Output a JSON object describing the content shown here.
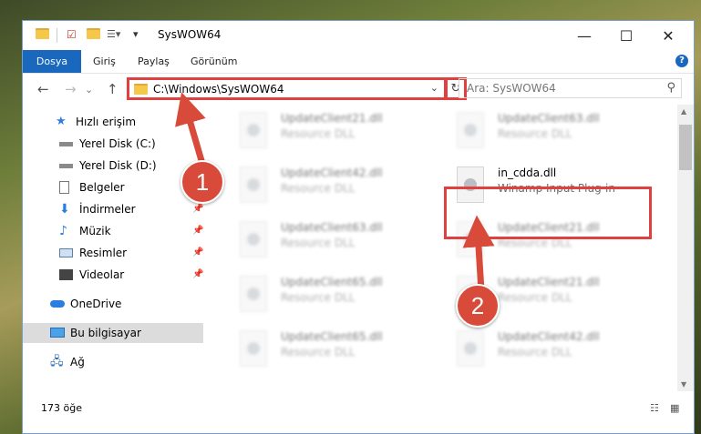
{
  "window": {
    "title": "SysWOW64",
    "controls": {
      "minimize": "—",
      "maximize": "☐",
      "close": "✕"
    }
  },
  "ribbon": {
    "tabs": [
      "Dosya",
      "Giriş",
      "Paylaş",
      "Görünüm"
    ],
    "help": "?"
  },
  "address": {
    "path": "C:\\Windows\\SysWOW64",
    "dropdown": "⌄",
    "refresh": "↻"
  },
  "search": {
    "placeholder": "Ara: SysWOW64",
    "icon": "search-icon"
  },
  "nav": {
    "back": "←",
    "forward": "→",
    "up": "↑",
    "quick_access": "Hızlı erişim",
    "items": [
      {
        "label": "Yerel Disk (C:)",
        "icon": "drive-icon",
        "pinned": false
      },
      {
        "label": "Yerel Disk (D:)",
        "icon": "drive-icon",
        "pinned": false
      },
      {
        "label": "Belgeler",
        "icon": "documents-icon",
        "pinned": false
      },
      {
        "label": "İndirmeler",
        "icon": "downloads-icon",
        "pinned": true
      },
      {
        "label": "Müzik",
        "icon": "music-icon",
        "pinned": true
      },
      {
        "label": "Resimler",
        "icon": "pictures-icon",
        "pinned": true
      },
      {
        "label": "Videolar",
        "icon": "videos-icon",
        "pinned": true
      }
    ],
    "onedrive": "OneDrive",
    "this_pc": "Bu bilgisayar",
    "network": "Ağ"
  },
  "files": [
    {
      "name": "UpdateClient21.dll",
      "desc": "Resource DLL"
    },
    {
      "name": "UpdateClient63.dll",
      "desc": "Resource DLL"
    },
    {
      "name": "UpdateClient42.dll",
      "desc": "Resource DLL"
    },
    {
      "name": "in_cdda.dll",
      "desc": "Winamp Input Plug-in"
    },
    {
      "name": "UpdateClient63.dll",
      "desc": "Resource DLL"
    },
    {
      "name": "UpdateClient21.dll",
      "desc": "Resource DLL"
    },
    {
      "name": "UpdateClient65.dll",
      "desc": "Resource DLL"
    },
    {
      "name": "UpdateClient21.dll",
      "desc": "Resource DLL"
    },
    {
      "name": "UpdateClient65.dll",
      "desc": "Resource DLL"
    },
    {
      "name": "UpdateClient42.dll",
      "desc": "Resource DLL"
    }
  ],
  "status": {
    "count": "173 öğe"
  },
  "annotations": {
    "step1": "1",
    "step2": "2",
    "color": "#d84a3a"
  }
}
